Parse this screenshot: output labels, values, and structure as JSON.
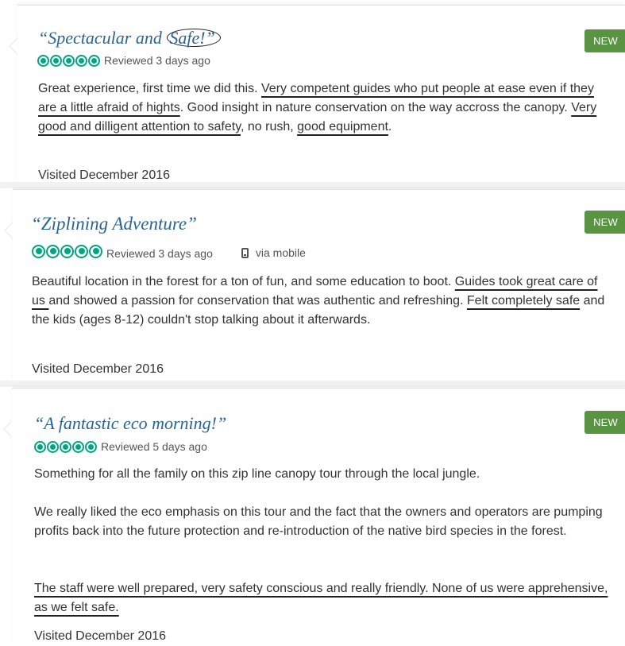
{
  "reviews": [
    {
      "title_open": "“Spectacular and ",
      "title_circled": "Safe!”",
      "badge": "NEW",
      "rating_text": "Reviewed 3 days ago",
      "p1_s1": "Great experience, first time we did this. ",
      "p1_u1": "Very competent guides who put people at ease even if they are a little afraid of hights",
      "p1_s2": ". Good insight in nature conservation on the way accross the canopy. ",
      "p1_u2": "Very good and dilligent attention to safety",
      "p1_s3": ", no rush, ",
      "p1_u3": "good equipment",
      "p1_s4": ".",
      "visited": "Visited December 2016"
    },
    {
      "title": "“Ziplining Adventure”",
      "badge": "NEW",
      "rating_text": "Reviewed 3 days ago",
      "mobile_text": "via mobile",
      "p1_s1": "Beautiful location in the forest for a ton of fun, and some education to boot. ",
      "p1_u1": "Guides took great care of us ",
      "p1_s2": "and showed a passion for conservation that was authentic and refreshing. ",
      "p1_u2": "Felt completely safe",
      "p1_s3": " and the kids (ages 8-12) couldn't stop talking about it afterwards.",
      "visited": "Visited December 2016"
    },
    {
      "title": "“A fantastic eco morning!”",
      "badge": "NEW",
      "rating_text": "Reviewed 5 days ago",
      "p1": "Something for all the family on this zip line canopy tour through the local jungle.",
      "p2": "We really liked the eco emphasis on this tour and the fact that the owners and operators are pumping profits back into the future protection and re-introduction of the native bird species in the forest.",
      "p3_u1": "The staff were well prepared, very safety conscious and really friendly. None of us were apprehensive, as we felt safe.",
      "visited": "Visited December 2016"
    }
  ],
  "colors": {
    "title": "#2a6496",
    "bubble": "#00a680",
    "badge": "#589442"
  },
  "icons": {
    "rating": "bubble-rating-icon",
    "mobile": "mobile-phone-icon"
  }
}
